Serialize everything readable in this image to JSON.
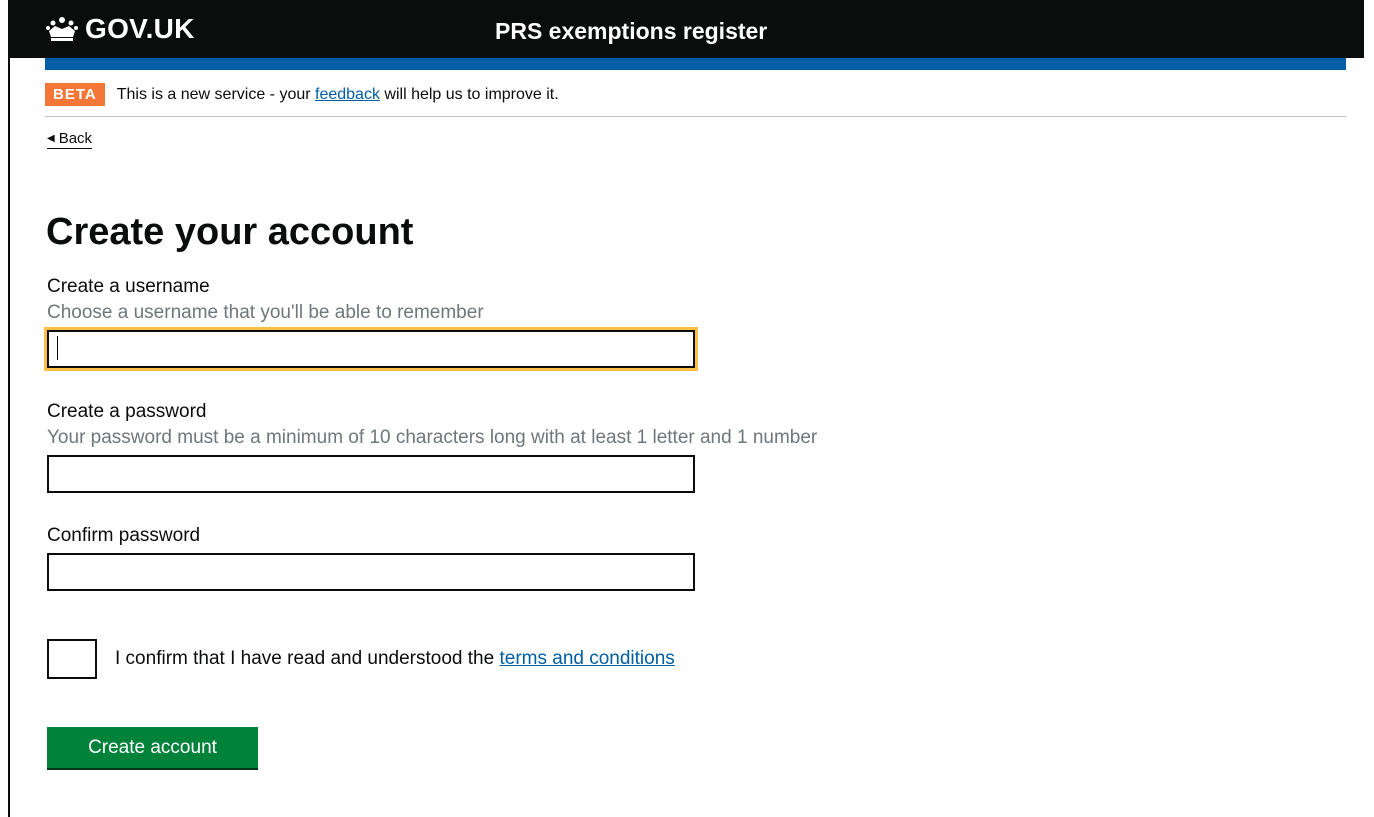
{
  "header": {
    "logo_text": "GOV.UK",
    "logo_icon": "crown-icon",
    "service_name": "PRS exemptions register",
    "colors": {
      "header_bg": "#0b0c0c",
      "blue_bar": "#005ea5"
    }
  },
  "phase_banner": {
    "tag": "BETA",
    "text_before": "This is a new service - your ",
    "link_text": "feedback",
    "text_after": " will help us to improve it.",
    "tag_color": "#f47738"
  },
  "back_link": {
    "label": "Back",
    "icon": "back-arrow-icon"
  },
  "page": {
    "title": "Create your account"
  },
  "form": {
    "username": {
      "label": "Create a username",
      "hint": "Choose a username that you'll be able to remember",
      "value": ""
    },
    "password": {
      "label": "Create a password",
      "hint": "Your password must be a minimum of 10 characters long with at least 1 letter and 1 number",
      "value": ""
    },
    "confirm_password": {
      "label": "Confirm password",
      "value": ""
    },
    "terms": {
      "label_before": "I confirm that I have read and understood the ",
      "link_text": "terms and conditions",
      "checked": false
    },
    "submit_label": "Create account",
    "colors": {
      "button": "#00823b",
      "focus": "#ffbf47",
      "link": "#005ea5",
      "hint": "#6f777b"
    }
  }
}
